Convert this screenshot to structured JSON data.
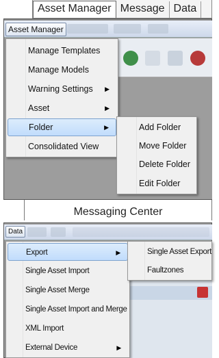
{
  "top_tabs": [
    "Asset Manager",
    "Message",
    "Data"
  ],
  "asset_menubar": {
    "active": "Asset Manager"
  },
  "asset_menu": {
    "items": [
      {
        "label": "Manage Templates",
        "submenu": false
      },
      {
        "label": "Manage Models",
        "submenu": false
      },
      {
        "label": "Warning Settings",
        "submenu": true
      },
      {
        "label": "Asset",
        "submenu": true
      },
      {
        "label": "Folder",
        "submenu": true,
        "highlighted": true
      },
      {
        "label": "Consolidated View",
        "submenu": false
      }
    ]
  },
  "folder_submenu": {
    "items": [
      "Add Folder",
      "Move Folder",
      "Delete Folder",
      "Edit Folder"
    ]
  },
  "banner": {
    "title": "Messaging Center"
  },
  "data_menubar": {
    "active": "Data"
  },
  "data_menu": {
    "items": [
      {
        "label": "Export",
        "submenu": true,
        "highlighted": true
      },
      {
        "label": "Single Asset Import",
        "submenu": false
      },
      {
        "label": "Single Asset Merge",
        "submenu": false
      },
      {
        "label": "Single Asset Import and Merge",
        "submenu": false
      },
      {
        "label": "XML Import",
        "submenu": false
      },
      {
        "label": "External Device",
        "submenu": true
      }
    ]
  },
  "export_submenu": {
    "items": [
      "Single Asset Export",
      "Faultzones"
    ]
  },
  "icons": {
    "submenu_arrow": "chevron-right-icon"
  },
  "colors": {
    "menu_bg": "#f0f0f0",
    "highlight": "#c1dcfc",
    "highlight_border": "#7da2ce",
    "app_bg": "#9d9d9d"
  }
}
